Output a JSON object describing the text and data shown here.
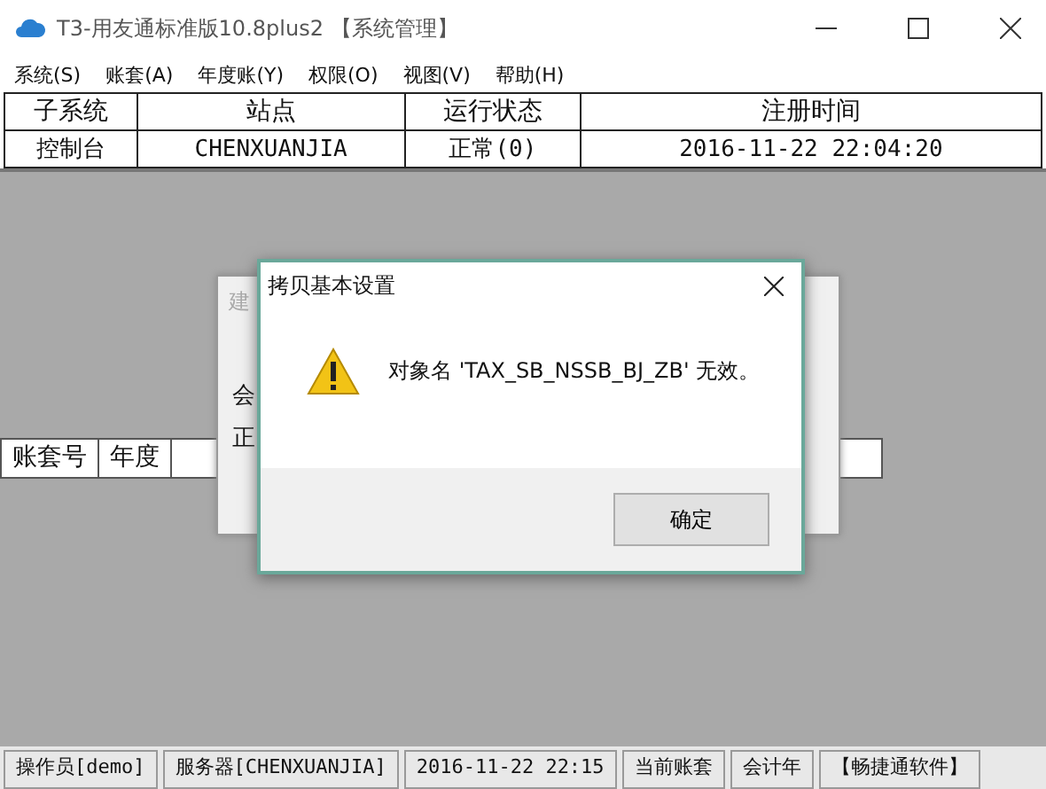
{
  "window": {
    "title": "T3-用友通标准版10.8plus2 【系统管理】"
  },
  "menu": [
    "系统(S)",
    "账套(A)",
    "年度账(Y)",
    "权限(O)",
    "视图(V)",
    "帮助(H)"
  ],
  "table": {
    "columns": [
      "子系统",
      "站点",
      "运行状态",
      "注册时间"
    ],
    "rows": [
      [
        "控制台",
        "CHENXUANJIA",
        "正常(0)",
        "2016-11-22 22:04:20"
      ]
    ]
  },
  "lower_table": {
    "columns": [
      "账套号",
      "年度"
    ]
  },
  "background_dialog": {
    "title": "建",
    "lines": [
      "会",
      "正"
    ]
  },
  "dialog": {
    "title": "拷贝基本设置",
    "message": "对象名 'TAX_SB_NSSB_BJ_ZB' 无效。",
    "button": "确定"
  },
  "status_bar": [
    "操作员[demo]",
    "服务器[CHENXUANJIA]",
    "2016-11-22 22:15",
    "当前账套",
    "会计年",
    "【畅捷通软件】"
  ]
}
